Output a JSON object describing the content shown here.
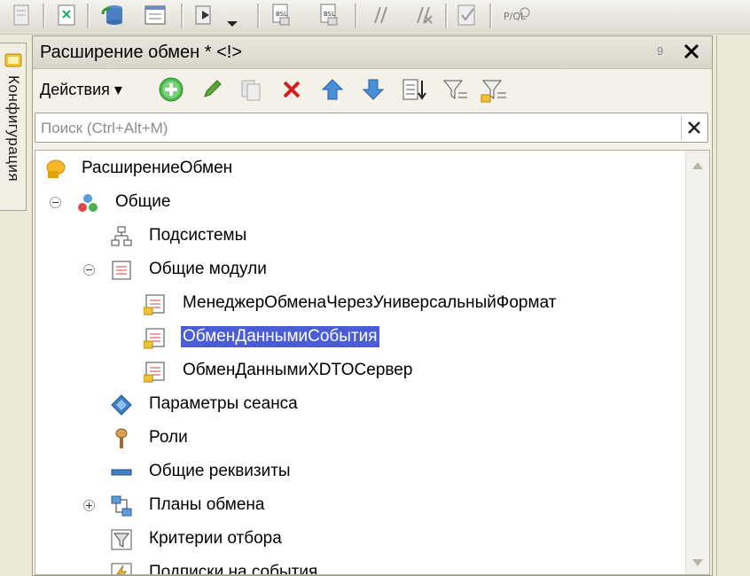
{
  "window": {
    "title": "Расширение обмен * <!>",
    "pin": "9"
  },
  "side_tab": {
    "label": "Конфигурация"
  },
  "actions": {
    "menu_label": "Действия ▾"
  },
  "search": {
    "placeholder": "Поиск (Ctrl+Alt+M)",
    "value": ""
  },
  "tree": {
    "root": "РасширениеОбмен",
    "items": [
      {
        "label": "Общие",
        "icon": "common-icon"
      },
      {
        "label": "Подсистемы",
        "icon": "subsystems-icon"
      },
      {
        "label": "Общие модули",
        "icon": "module-icon"
      },
      {
        "label": "МенеджерОбменаЧерезУниверсальныйФормат",
        "icon": "module-icon"
      },
      {
        "label": "ОбменДаннымиСобытия",
        "icon": "module-icon",
        "selected": true
      },
      {
        "label": "ОбменДаннымиXDTOСервер",
        "icon": "module-icon"
      },
      {
        "label": "Параметры сеанса",
        "icon": "session-params-icon"
      },
      {
        "label": "Роли",
        "icon": "roles-icon"
      },
      {
        "label": "Общие реквизиты",
        "icon": "common-attributes-icon"
      },
      {
        "label": "Планы обмена",
        "icon": "exchange-plans-icon"
      },
      {
        "label": "Критерии отбора",
        "icon": "filter-criteria-icon"
      },
      {
        "label": "Подписки на события",
        "icon": "event-subscriptions-icon"
      }
    ]
  },
  "colors": {
    "selection": "#4a5cd6",
    "accent_green": "#3aa03a",
    "accent_red": "#d22020",
    "accent_blue": "#2f78c8"
  }
}
